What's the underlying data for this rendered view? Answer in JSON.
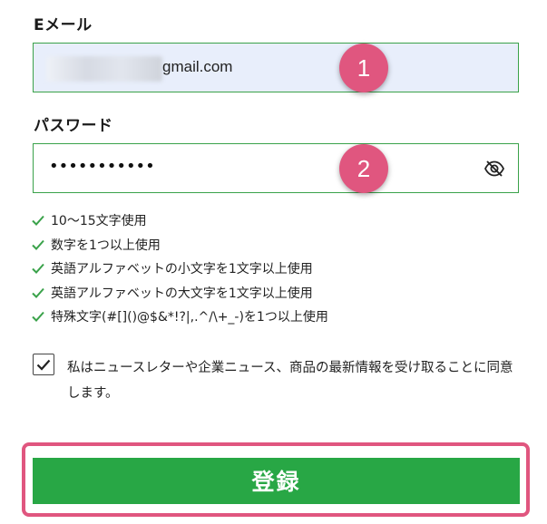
{
  "form": {
    "email": {
      "label": "Eメール",
      "value_visible": "gmail.com"
    },
    "password": {
      "label": "パスワード",
      "value_masked": "•••••••••••",
      "toggle_icon": "eye-off-icon"
    }
  },
  "annotations": {
    "step1": "1",
    "step2": "2",
    "badge_color": "#e0567f"
  },
  "password_rules": [
    "10～15文字使用",
    "数字を1つ以上使用",
    "英語アルファベットの小文字を1文字以上使用",
    "英語アルファベットの大文字を1文字以上使用",
    "特殊文字(#[]()@$&*!?|,.^/\\+_-)を1つ以上使用"
  ],
  "consent": {
    "checked": true,
    "text": "私はニュースレターや企業ニュース、商品の最新情報を受け取ることに同意します。"
  },
  "submit": {
    "label": "登録",
    "color": "#28a745"
  },
  "theme": {
    "accent_green": "#3aa24a",
    "highlight_pink": "#e0567f"
  }
}
